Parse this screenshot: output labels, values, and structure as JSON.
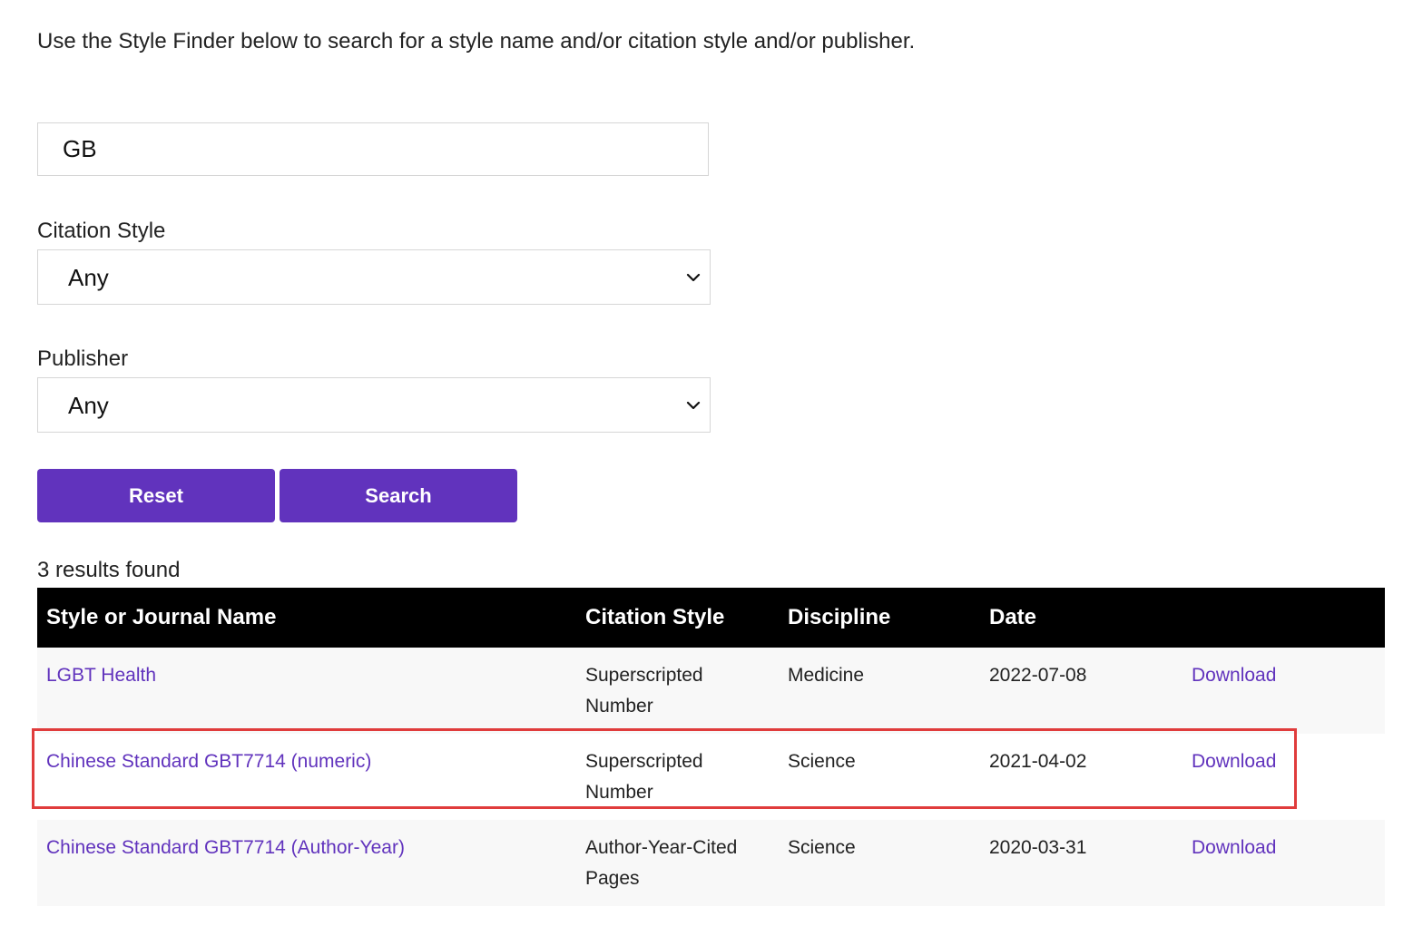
{
  "intro": "Use the Style Finder below to search for a style name and/or citation style and/or publisher.",
  "search": {
    "value": "GB"
  },
  "citation_style": {
    "label": "Citation Style",
    "selected": "Any"
  },
  "publisher": {
    "label": "Publisher",
    "selected": "Any"
  },
  "buttons": {
    "reset": "Reset",
    "search": "Search"
  },
  "results": {
    "count_text": "3 results found",
    "headers": [
      "Style or Journal Name",
      "Citation Style",
      "Discipline",
      "Date",
      ""
    ],
    "rows": [
      {
        "name": "LGBT Health",
        "citation_style": "Superscripted Number",
        "discipline": "Medicine",
        "date": "2022-07-08",
        "action": "Download"
      },
      {
        "name": "Chinese Standard GBT7714 (numeric)",
        "citation_style": "Superscripted Number",
        "discipline": "Science",
        "date": "2021-04-02",
        "action": "Download"
      },
      {
        "name": "Chinese Standard GBT7714 (Author-Year)",
        "citation_style": "Author-Year-Cited Pages",
        "discipline": "Science",
        "date": "2020-03-31",
        "action": "Download"
      }
    ]
  },
  "colors": {
    "accent": "#6133bd",
    "header_bg": "#000000",
    "highlight": "#e03c3c"
  }
}
